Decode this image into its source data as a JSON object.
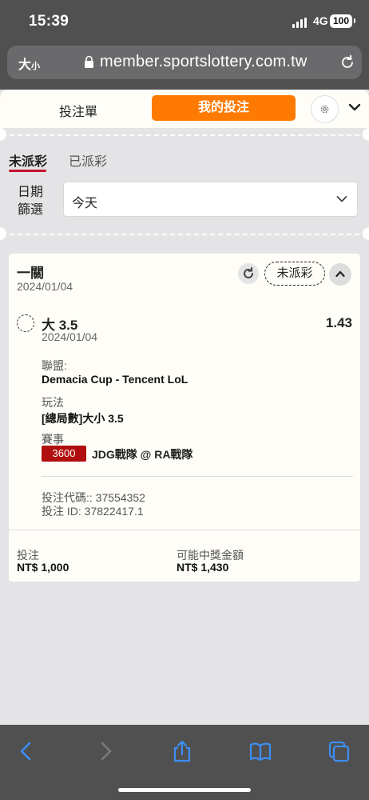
{
  "status_bar": {
    "time": "15:39",
    "network": "4G",
    "battery": "100"
  },
  "browser": {
    "text_size_label": "大",
    "text_size_small": "小",
    "url": "member.sportslottery.com.tw"
  },
  "header": {
    "tab_betslip": "投注單",
    "tab_mybets": "我的投注"
  },
  "status_tabs": {
    "active": "未派彩",
    "other": "已派彩"
  },
  "filter": {
    "label_line1": "日期",
    "label_line2": "篩選",
    "selected": "今天"
  },
  "bet": {
    "type": "一關",
    "date": "2024/01/04",
    "status": "未派彩",
    "selection": "大 3.5",
    "selection_date": "2024/01/04",
    "odds": "1.43",
    "league_label": "聯盟:",
    "league": "Demacia Cup - Tencent LoL",
    "market_label": "玩法",
    "market": "[總局數]大小 3.5",
    "event_label": "賽事",
    "event_code": "3600",
    "event": "JDG戰隊 @ RA戰隊",
    "bet_code": "投注代碼:: 37554352",
    "bet_id": "投注 ID: 37822417.1",
    "stake_label": "投注",
    "stake": "NT$ 1,000",
    "payout_label": "可能中獎金額",
    "payout": "NT$ 1,430"
  }
}
